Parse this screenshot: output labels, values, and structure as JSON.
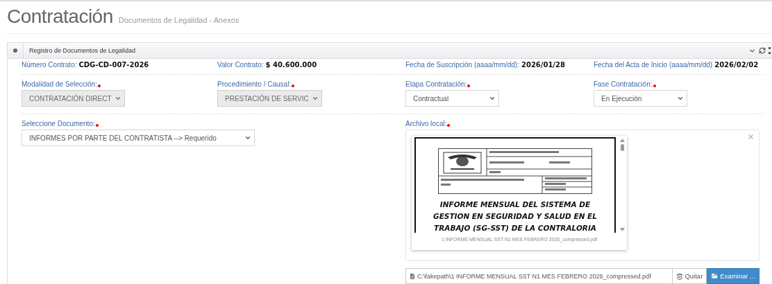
{
  "header": {
    "title": "Contratación",
    "subtitle": "Documentos de Legalidad - Anexos"
  },
  "panel": {
    "title": "Registro de Documentos de Legalidad",
    "info": [
      {
        "label": "Número Contrato:",
        "value": "CDG-CD-007-2026"
      },
      {
        "label": "Valor Contrato:",
        "value": "$ 40.600.000"
      },
      {
        "label": "Fecha de Suscripción (aaaa/mm/dd):",
        "value": "2026/01/28"
      },
      {
        "label": "Fecha del Acta de Inicio (aaaa/mm/dd)",
        "value": "2026/02/02"
      }
    ],
    "selects": [
      {
        "label": "Modalidad de Selección:",
        "required": true,
        "value": "CONTRATACIÓN DIRECT",
        "disabled": true
      },
      {
        "label": "Procedimiento / Causal:",
        "required": true,
        "value": "PRESTACIÓN DE SERVIC",
        "disabled": true
      },
      {
        "label": "Etapa Contratación:",
        "required": true,
        "value": "Contractual",
        "disabled": false
      },
      {
        "label": "Fase Contratación:",
        "required": true,
        "value": "En Ejecución",
        "disabled": false
      }
    ],
    "document": {
      "label": "Seleccione Documento:",
      "required": true,
      "value": "INFORMES POR PARTE DEL CONTRATISTA --> Requerido",
      "disabled": false
    },
    "file": {
      "label": "Archivo local:",
      "required": true,
      "preview": {
        "title_lines": [
          "INFORME MENSUAL DEL SISTEMA DE",
          "GESTION EN SEGURIDAD Y SALUD EN EL",
          "TRABAJO (SG-SST) DE LA CONTRALORIA"
        ],
        "caption": "1 INFORME MENSUAL SST N1 MES FEBRERO 2026_compressed.pdf"
      },
      "path": "C:\\fakepath\\1 INFORME MENSUAL SST N1 MES FEBRERO 2026_compressed.pdf",
      "remove": "Quitar",
      "browse": "Examinar ..."
    }
  }
}
